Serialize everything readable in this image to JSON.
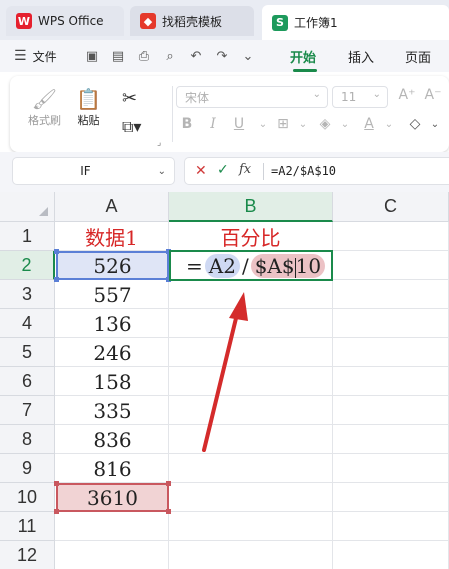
{
  "tabs": [
    {
      "label": "WPS Office",
      "icon": "wps-logo-icon"
    },
    {
      "label": "找稻壳模板",
      "icon": "template-icon"
    },
    {
      "label": "工作簿1",
      "icon": "spreadsheet-icon",
      "icon_letter": "S"
    }
  ],
  "menu": {
    "file_label": "文件",
    "tabs": [
      "开始",
      "插入",
      "页面"
    ],
    "active_tab": "开始"
  },
  "ribbon": {
    "format_painter": "格式刷",
    "paste": "粘贴",
    "font_name": "宋体",
    "font_size": "11"
  },
  "formula_bar": {
    "name_box": "IF",
    "formula": "=A2/$A$10"
  },
  "sheet": {
    "columns": [
      "A",
      "B",
      "C"
    ],
    "selected_column": "B",
    "rows": [
      "1",
      "2",
      "3",
      "4",
      "5",
      "6",
      "7",
      "8",
      "9",
      "10",
      "11",
      "12"
    ],
    "selected_row": "2",
    "header_a": "数据1",
    "header_b": "百分比",
    "values_a": [
      "526",
      "557",
      "136",
      "246",
      "158",
      "335",
      "836",
      "816",
      "3610"
    ],
    "editing": {
      "equals": "=",
      "ref1": "A2",
      "op": "/",
      "ref2": "$A$",
      "ref2_tail": "10"
    }
  },
  "colors": {
    "accent": "#1a8a4b",
    "ref_blue": "#5b7fd6",
    "ref_red": "#c9585f",
    "arrow": "#d42b2b",
    "header_text": "#d72727"
  }
}
